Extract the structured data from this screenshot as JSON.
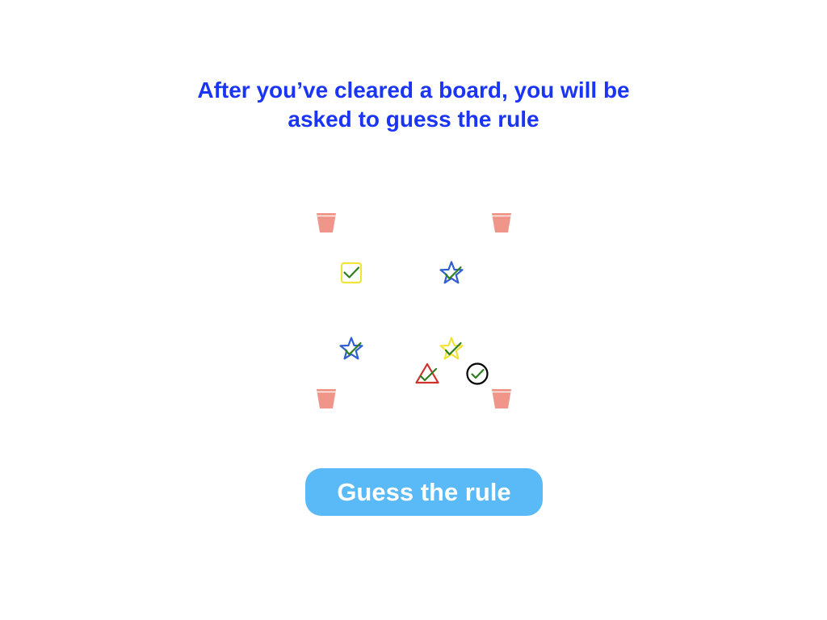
{
  "instruction": {
    "line1": "After you’ve cleared a board, you will be",
    "line2": "asked to guess the rule"
  },
  "colors": {
    "instruction_text": "#1a35f5",
    "bucket": "#f0958a",
    "button_bg": "#5ab9f7",
    "button_text": "#ffffff",
    "check": "#2e7d1f",
    "yellow": "#f2e33b",
    "blue": "#2f5fd0",
    "red": "#d0312d",
    "black": "#000000"
  },
  "board": {
    "buckets": [
      {
        "name": "bucket-top-left-icon",
        "icon": "bucket"
      },
      {
        "name": "bucket-top-right-icon",
        "icon": "bucket"
      },
      {
        "name": "bucket-bottom-left-icon",
        "icon": "bucket"
      },
      {
        "name": "bucket-bottom-right-icon",
        "icon": "bucket"
      }
    ],
    "pieces": [
      {
        "name": "yellow-square-checked-icon",
        "shape": "square",
        "color": "yellow",
        "checked": true
      },
      {
        "name": "blue-star-checked-icon",
        "shape": "star",
        "color": "blue",
        "checked": true
      },
      {
        "name": "blue-star-checked-icon",
        "shape": "star",
        "color": "blue",
        "checked": true
      },
      {
        "name": "yellow-star-checked-icon",
        "shape": "star",
        "color": "yellow",
        "checked": true
      },
      {
        "name": "red-triangle-checked-icon",
        "shape": "triangle",
        "color": "red",
        "checked": true
      },
      {
        "name": "black-circle-checked-icon",
        "shape": "circle",
        "color": "black",
        "checked": true
      }
    ]
  },
  "button": {
    "label": "Guess the rule"
  }
}
